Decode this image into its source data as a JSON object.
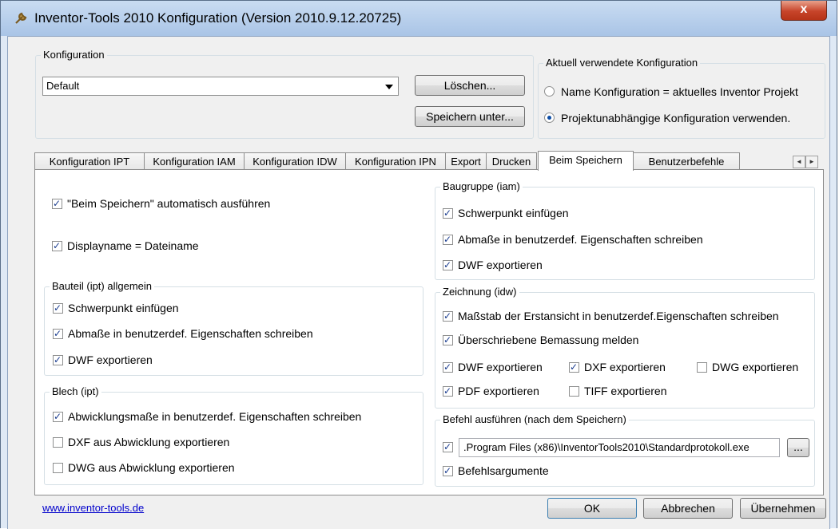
{
  "window": {
    "title": "Inventor-Tools 2010 Konfiguration (Version 2010.9.12.20725)",
    "close_label": "x",
    "app_icon": "wrench-icon"
  },
  "konfiguration": {
    "group_title": "Konfiguration",
    "selected": "Default",
    "delete_label": "Löschen...",
    "save_as_label": "Speichern unter..."
  },
  "aktuell": {
    "group_title": "Aktuell verwendete Konfiguration",
    "option_project": "Name Konfiguration = aktuelles Inventor Projekt",
    "option_independent": "Projektunabhängige Konfiguration verwenden.",
    "selected": "independent"
  },
  "tabs": [
    {
      "label": "Konfiguration IPT",
      "active": false
    },
    {
      "label": "Konfiguration IAM",
      "active": false
    },
    {
      "label": "Konfiguration IDW",
      "active": false
    },
    {
      "label": "Konfiguration IPN",
      "active": false
    },
    {
      "label": "Export",
      "active": false
    },
    {
      "label": "Drucken",
      "active": false
    },
    {
      "label": "Beim Speichern",
      "active": true
    },
    {
      "label": "Benutzerbefehle",
      "active": false
    }
  ],
  "tab_scroll": {
    "left": "◄",
    "right": "►"
  },
  "general": {
    "auto_run": {
      "label": "\"Beim Speichern\" automatisch ausführen",
      "checked": true
    },
    "display_name": {
      "label": "Displayname = Dateiname",
      "checked": true
    }
  },
  "bauteil": {
    "group_title": "Bauteil (ipt) allgemein",
    "items": [
      {
        "label": "Schwerpunkt einfügen",
        "checked": true
      },
      {
        "label": "Abmaße in benutzerdef. Eigenschaften schreiben",
        "checked": true
      },
      {
        "label": "DWF exportieren",
        "checked": true
      }
    ]
  },
  "blech": {
    "group_title": "Blech (ipt)",
    "items": [
      {
        "label": "Abwicklungsmaße in benutzerdef. Eigenschaften schreiben",
        "checked": true
      },
      {
        "label": "DXF aus Abwicklung exportieren",
        "checked": false
      },
      {
        "label": "DWG aus Abwicklung exportieren",
        "checked": false
      }
    ]
  },
  "baugruppe": {
    "group_title": "Baugruppe (iam)",
    "items": [
      {
        "label": "Schwerpunkt einfügen",
        "checked": true
      },
      {
        "label": "Abmaße in benutzerdef. Eigenschaften schreiben",
        "checked": true
      },
      {
        "label": "DWF exportieren",
        "checked": true
      }
    ]
  },
  "zeichnung": {
    "group_title": "Zeichnung (idw)",
    "scale": {
      "label": "Maßstab der Erstansicht in benutzerdef.Eigenschaften schreiben",
      "checked": true
    },
    "overwritten": {
      "label": "Überschriebene Bemassung melden",
      "checked": true
    },
    "dwf": {
      "label": "DWF exportieren",
      "checked": true
    },
    "dxf": {
      "label": "DXF exportieren",
      "checked": true
    },
    "dwg": {
      "label": "DWG exportieren",
      "checked": false
    },
    "pdf": {
      "label": "PDF exportieren",
      "checked": true
    },
    "tiff": {
      "label": "TIFF exportieren",
      "checked": false
    }
  },
  "befehl": {
    "group_title": "Befehl ausführen (nach dem Speichern)",
    "enabled": true,
    "path": ".Program Files (x86)\\InventorTools2010\\Standardprotokoll.exe",
    "browse_label": "...",
    "args": {
      "label": "Befehlsargumente",
      "checked": true
    }
  },
  "footer": {
    "link": "www.inventor-tools.de",
    "ok_label": "OK",
    "cancel_label": "Abbrechen",
    "apply_label": "Übernehmen"
  }
}
